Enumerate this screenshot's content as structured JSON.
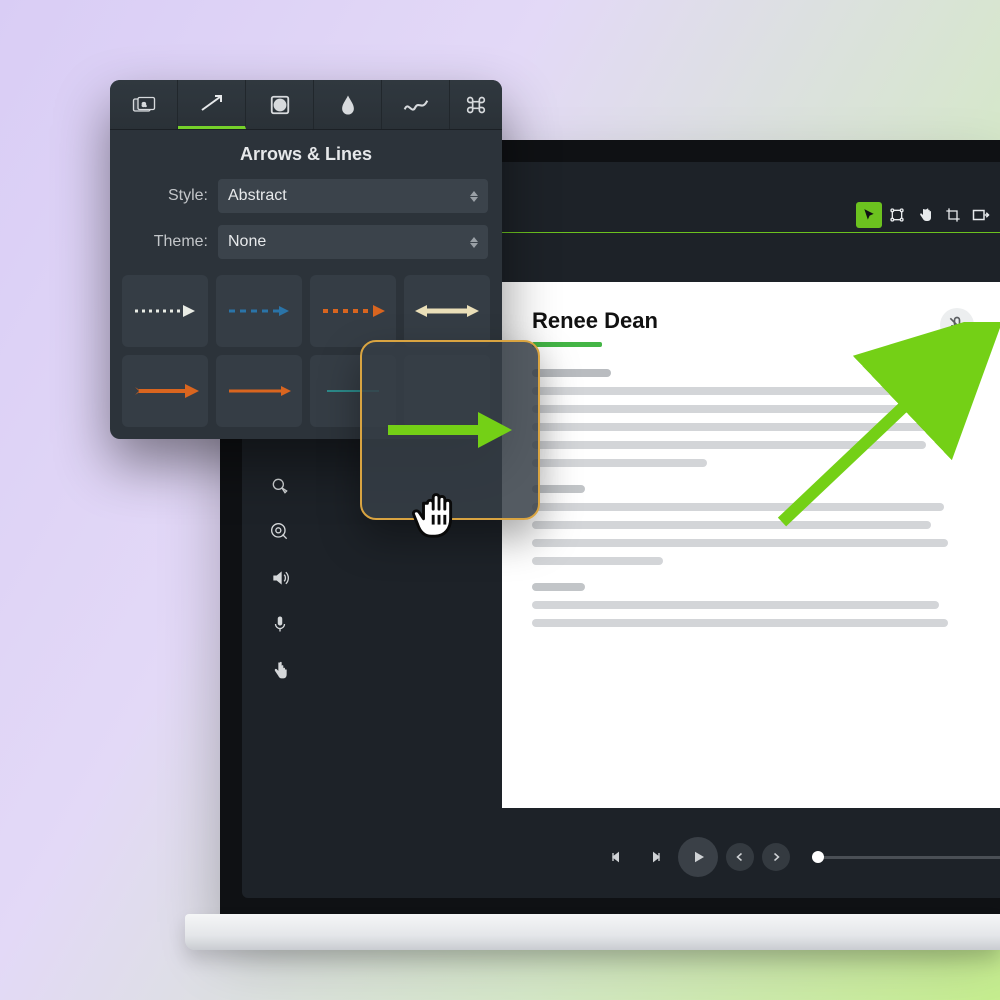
{
  "palette": {
    "title": "Arrows & Lines",
    "style_label": "Style:",
    "style_value": "Abstract",
    "theme_label": "Theme:",
    "theme_value": "None",
    "tabs": [
      "text",
      "arrow",
      "shape",
      "blur",
      "squiggle",
      "shortcut"
    ]
  },
  "document": {
    "title": "Renee Dean"
  },
  "colors": {
    "accent": "#76d12a",
    "orange": "#d9651f",
    "teal": "#2c8a8a",
    "blue": "#2a74a8"
  }
}
